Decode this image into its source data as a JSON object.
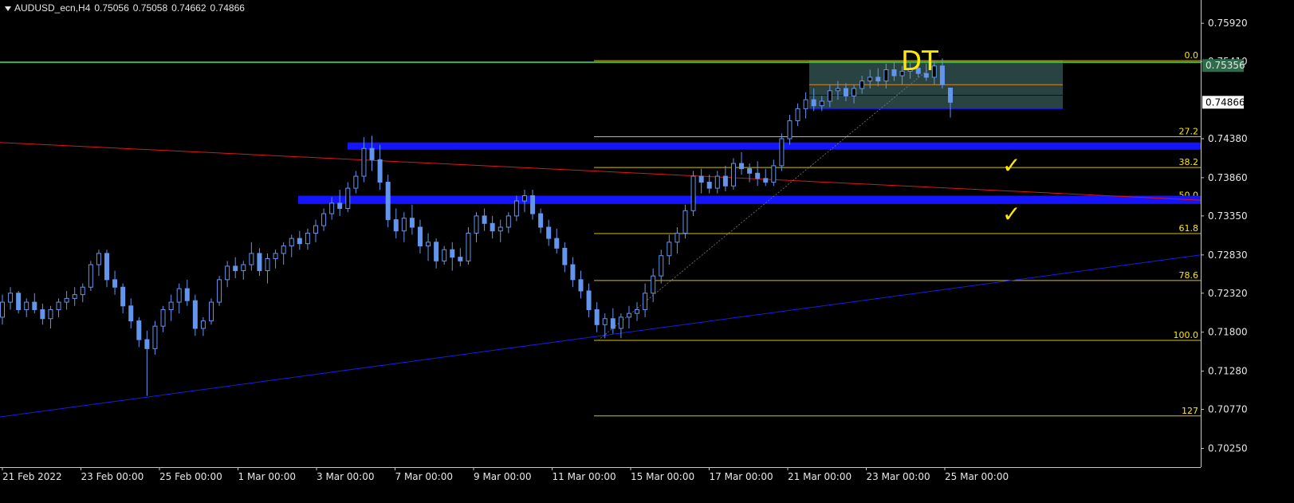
{
  "header": {
    "symbol": "AUDUSD_ecn,H4",
    "open": "0.75056",
    "high": "0.75058",
    "low": "0.74662",
    "close": "0.74866"
  },
  "colors": {
    "background": "#000000",
    "candle": "#6495ED",
    "fib": "#d4c400",
    "fib_label": "#ffe800",
    "zone": "#1414ff",
    "green_line": "#3fae5a",
    "red_line": "#d81818",
    "blue_trend": "#1a1aee",
    "box": "#2e4a4a",
    "annotation": "#ffe800",
    "axis_text": "#e6e6e6"
  },
  "chart_data": {
    "type": "candlestick",
    "y_axis": {
      "ticks": [
        "0.75920",
        "0.75410",
        "0.74380",
        "0.73860",
        "0.73350",
        "0.72830",
        "0.72320",
        "0.71800",
        "0.71280",
        "0.70770",
        "0.70250"
      ],
      "ylim": [
        0.7,
        0.7623
      ]
    },
    "x_axis": {
      "ticks": [
        "21 Feb 2022",
        "23 Feb 00:00",
        "25 Feb 00:00",
        "1 Mar 00:00",
        "3 Mar 00:00",
        "7 Mar 00:00",
        "9 Mar 00:00",
        "11 Mar 00:00",
        "15 Mar 00:00",
        "17 Mar 00:00",
        "21 Mar 00:00",
        "23 Mar 00:00",
        "25 Mar 00:00"
      ]
    },
    "price_labels": [
      {
        "value": 0.75356,
        "text": "0.75356",
        "style": "highlight"
      },
      {
        "value": 0.74866,
        "text": "0.74866",
        "style": "current"
      }
    ],
    "fibonacci": {
      "high": 0.75421,
      "low": 0.7169,
      "levels": [
        {
          "ratio": 0.0,
          "label": "0.0"
        },
        {
          "ratio": 0.272,
          "label": "27.2"
        },
        {
          "ratio": 0.382,
          "label": "38.2"
        },
        {
          "ratio": 0.5,
          "label": "50.0"
        },
        {
          "ratio": 0.618,
          "label": "61.8"
        },
        {
          "ratio": 0.786,
          "label": "78.6"
        },
        {
          "ratio": 1.0,
          "label": "100.0"
        },
        {
          "ratio": 1.27,
          "label": "127"
        }
      ]
    },
    "zones": [
      {
        "top": 0.7433,
        "bottom": 0.7424
      },
      {
        "top": 0.7362,
        "bottom": 0.7351
      }
    ],
    "horizontal_lines": [
      {
        "value": 0.754,
        "color": "green"
      }
    ],
    "trend_lines": [
      {
        "name": "red",
        "from": {
          "x": 0.0,
          "y": 0.7433
        },
        "to": {
          "x": 1.0,
          "y": 0.7356
        }
      },
      {
        "name": "blue",
        "from": {
          "x": 0.0,
          "y": 0.7067
        },
        "to": {
          "x": 1.0,
          "y": 0.7283
        }
      }
    ],
    "range_box": {
      "top": 0.75421,
      "bottom": 0.7478,
      "mid_levels": [
        0.751,
        0.7496
      ]
    },
    "annotations": [
      {
        "text": "DT"
      },
      {
        "symbol": "✓"
      },
      {
        "symbol": "✓"
      }
    ],
    "candles": [
      [
        0.72,
        0.723,
        0.719,
        0.722
      ],
      [
        0.722,
        0.724,
        0.721,
        0.7232
      ],
      [
        0.7232,
        0.7235,
        0.7205,
        0.721
      ],
      [
        0.721,
        0.7225,
        0.72,
        0.722
      ],
      [
        0.722,
        0.7232,
        0.7205,
        0.721
      ],
      [
        0.721,
        0.7218,
        0.719,
        0.7198
      ],
      [
        0.7198,
        0.7215,
        0.7185,
        0.721
      ],
      [
        0.721,
        0.7225,
        0.72,
        0.722
      ],
      [
        0.722,
        0.7235,
        0.721,
        0.7225
      ],
      [
        0.7225,
        0.724,
        0.7215,
        0.723
      ],
      [
        0.723,
        0.7245,
        0.722,
        0.724
      ],
      [
        0.724,
        0.7275,
        0.7235,
        0.727
      ],
      [
        0.727,
        0.729,
        0.7255,
        0.7285
      ],
      [
        0.7285,
        0.729,
        0.724,
        0.725
      ],
      [
        0.725,
        0.7262,
        0.723,
        0.724
      ],
      [
        0.724,
        0.7245,
        0.7205,
        0.7215
      ],
      [
        0.7215,
        0.7225,
        0.7185,
        0.7195
      ],
      [
        0.7195,
        0.72,
        0.716,
        0.717
      ],
      [
        0.717,
        0.7182,
        0.7095,
        0.7158
      ],
      [
        0.7158,
        0.7195,
        0.715,
        0.7188
      ],
      [
        0.7188,
        0.7215,
        0.718,
        0.721
      ],
      [
        0.721,
        0.723,
        0.7195,
        0.722
      ],
      [
        0.722,
        0.7245,
        0.7205,
        0.7238
      ],
      [
        0.7238,
        0.725,
        0.7215,
        0.7222
      ],
      [
        0.7222,
        0.723,
        0.7175,
        0.7185
      ],
      [
        0.7185,
        0.72,
        0.7175,
        0.7195
      ],
      [
        0.7195,
        0.7225,
        0.719,
        0.722
      ],
      [
        0.722,
        0.7255,
        0.7215,
        0.725
      ],
      [
        0.725,
        0.7275,
        0.724,
        0.7268
      ],
      [
        0.7268,
        0.728,
        0.7252,
        0.7262
      ],
      [
        0.7262,
        0.7275,
        0.725,
        0.727
      ],
      [
        0.727,
        0.73,
        0.7262,
        0.7285
      ],
      [
        0.7285,
        0.7292,
        0.7255,
        0.7262
      ],
      [
        0.7262,
        0.7285,
        0.7245,
        0.7278
      ],
      [
        0.7278,
        0.729,
        0.7265,
        0.7285
      ],
      [
        0.7285,
        0.73,
        0.727,
        0.7295
      ],
      [
        0.7295,
        0.731,
        0.728,
        0.7305
      ],
      [
        0.7305,
        0.7315,
        0.729,
        0.7298
      ],
      [
        0.7298,
        0.7318,
        0.729,
        0.7312
      ],
      [
        0.7312,
        0.733,
        0.73,
        0.7322
      ],
      [
        0.7322,
        0.7345,
        0.7315,
        0.7338
      ],
      [
        0.7338,
        0.736,
        0.733,
        0.7352
      ],
      [
        0.7352,
        0.737,
        0.7335,
        0.7345
      ],
      [
        0.7345,
        0.738,
        0.734,
        0.7372
      ],
      [
        0.7372,
        0.7395,
        0.7365,
        0.7388
      ],
      [
        0.7388,
        0.744,
        0.738,
        0.7425
      ],
      [
        0.7425,
        0.7442,
        0.7395,
        0.741
      ],
      [
        0.741,
        0.743,
        0.737,
        0.738
      ],
      [
        0.738,
        0.739,
        0.732,
        0.733
      ],
      [
        0.733,
        0.7345,
        0.7305,
        0.7315
      ],
      [
        0.7315,
        0.734,
        0.73,
        0.7332
      ],
      [
        0.7332,
        0.735,
        0.731,
        0.732
      ],
      [
        0.732,
        0.733,
        0.7285,
        0.7295
      ],
      [
        0.7295,
        0.7312,
        0.7275,
        0.73
      ],
      [
        0.73,
        0.7305,
        0.7265,
        0.7275
      ],
      [
        0.7275,
        0.7295,
        0.727,
        0.729
      ],
      [
        0.729,
        0.73,
        0.7262,
        0.728
      ],
      [
        0.728,
        0.7292,
        0.7268,
        0.7275
      ],
      [
        0.7275,
        0.732,
        0.727,
        0.7312
      ],
      [
        0.7312,
        0.734,
        0.73,
        0.7335
      ],
      [
        0.7335,
        0.7345,
        0.7315,
        0.7325
      ],
      [
        0.7325,
        0.7335,
        0.7305,
        0.7315
      ],
      [
        0.7315,
        0.733,
        0.73,
        0.732
      ],
      [
        0.732,
        0.734,
        0.7312,
        0.7335
      ],
      [
        0.7335,
        0.7362,
        0.7328,
        0.7355
      ],
      [
        0.7355,
        0.737,
        0.734,
        0.7362
      ],
      [
        0.7362,
        0.737,
        0.733,
        0.7338
      ],
      [
        0.7338,
        0.7345,
        0.7312,
        0.732
      ],
      [
        0.732,
        0.733,
        0.7295,
        0.7305
      ],
      [
        0.7305,
        0.7318,
        0.7285,
        0.7292
      ],
      [
        0.7292,
        0.73,
        0.726,
        0.727
      ],
      [
        0.727,
        0.728,
        0.724,
        0.725
      ],
      [
        0.725,
        0.7262,
        0.7225,
        0.7235
      ],
      [
        0.7235,
        0.7245,
        0.72,
        0.721
      ],
      [
        0.721,
        0.722,
        0.718,
        0.719
      ],
      [
        0.719,
        0.7205,
        0.7172,
        0.7198
      ],
      [
        0.7198,
        0.7212,
        0.7178,
        0.7185
      ],
      [
        0.7185,
        0.7205,
        0.7172,
        0.72
      ],
      [
        0.72,
        0.7215,
        0.7185,
        0.7205
      ],
      [
        0.7205,
        0.722,
        0.7195,
        0.721
      ],
      [
        0.721,
        0.7245,
        0.72,
        0.7232
      ],
      [
        0.7232,
        0.7265,
        0.722,
        0.7255
      ],
      [
        0.7255,
        0.729,
        0.7245,
        0.7282
      ],
      [
        0.7282,
        0.731,
        0.727,
        0.73
      ],
      [
        0.73,
        0.732,
        0.7285,
        0.7312
      ],
      [
        0.7312,
        0.735,
        0.7305,
        0.7342
      ],
      [
        0.7342,
        0.7395,
        0.7335,
        0.7388
      ],
      [
        0.7388,
        0.7398,
        0.7365,
        0.738
      ],
      [
        0.738,
        0.739,
        0.7365,
        0.7372
      ],
      [
        0.7372,
        0.7395,
        0.7365,
        0.7388
      ],
      [
        0.7388,
        0.7402,
        0.7368,
        0.7375
      ],
      [
        0.7375,
        0.7412,
        0.737,
        0.7405
      ],
      [
        0.7405,
        0.742,
        0.739,
        0.7398
      ],
      [
        0.7398,
        0.7405,
        0.738,
        0.7392
      ],
      [
        0.7392,
        0.7408,
        0.7375,
        0.7385
      ],
      [
        0.7385,
        0.7398,
        0.7375,
        0.738
      ],
      [
        0.738,
        0.741,
        0.7375,
        0.7402
      ],
      [
        0.7402,
        0.7445,
        0.7395,
        0.7438
      ],
      [
        0.7438,
        0.747,
        0.743,
        0.7462
      ],
      [
        0.7462,
        0.7485,
        0.7455,
        0.7478
      ],
      [
        0.7478,
        0.75,
        0.7465,
        0.749
      ],
      [
        0.749,
        0.7505,
        0.7475,
        0.7482
      ],
      [
        0.7482,
        0.7495,
        0.7475,
        0.7488
      ],
      [
        0.7488,
        0.751,
        0.748,
        0.7502
      ],
      [
        0.7502,
        0.7515,
        0.749,
        0.7505
      ],
      [
        0.7505,
        0.7512,
        0.7488,
        0.7495
      ],
      [
        0.7495,
        0.751,
        0.7485,
        0.7505
      ],
      [
        0.7505,
        0.7522,
        0.7498,
        0.7515
      ],
      [
        0.7515,
        0.753,
        0.7505,
        0.752
      ],
      [
        0.752,
        0.7532,
        0.7508,
        0.7515
      ],
      [
        0.7515,
        0.7538,
        0.7505,
        0.753
      ],
      [
        0.753,
        0.754,
        0.7515,
        0.7522
      ],
      [
        0.7522,
        0.7535,
        0.751,
        0.7528
      ],
      [
        0.7528,
        0.754,
        0.7518,
        0.7532
      ],
      [
        0.7532,
        0.7542,
        0.752,
        0.7525
      ],
      [
        0.7525,
        0.7538,
        0.7515,
        0.752
      ],
      [
        0.752,
        0.7542,
        0.751,
        0.7535
      ],
      [
        0.7535,
        0.7545,
        0.7505,
        0.751
      ],
      [
        0.75056,
        0.75058,
        0.74662,
        0.74866
      ]
    ]
  }
}
